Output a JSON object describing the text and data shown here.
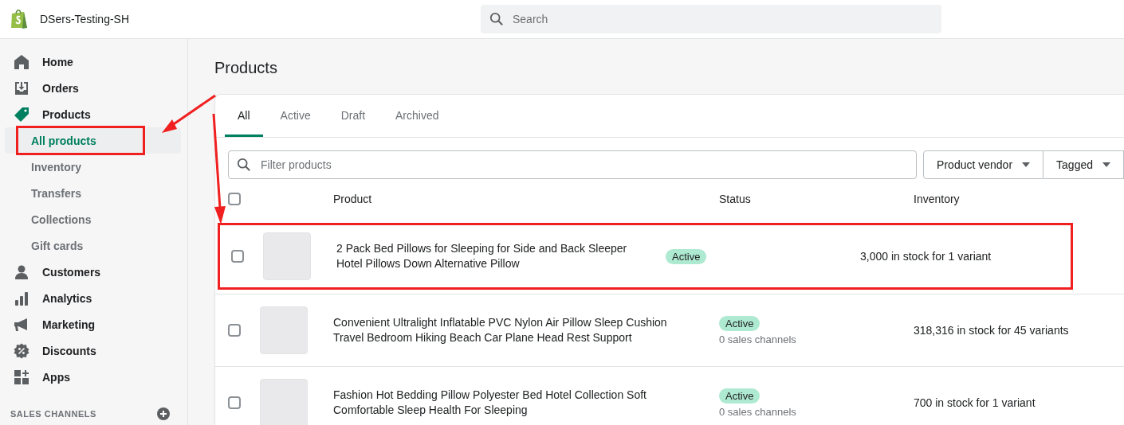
{
  "store": {
    "name": "DSers-Testing-SH"
  },
  "search": {
    "placeholder": "Search"
  },
  "sidebar": {
    "items": [
      {
        "label": "Home",
        "selected": false
      },
      {
        "label": "Orders",
        "selected": false
      },
      {
        "label": "Products",
        "selected": true,
        "children": [
          {
            "label": "All products",
            "selected": true,
            "highlighted": true
          },
          {
            "label": "Inventory",
            "selected": false,
            "highlighted": false
          },
          {
            "label": "Transfers",
            "selected": false,
            "highlighted": false
          },
          {
            "label": "Collections",
            "selected": false,
            "highlighted": false
          },
          {
            "label": "Gift cards",
            "selected": false,
            "highlighted": false
          }
        ]
      },
      {
        "label": "Customers",
        "selected": false
      },
      {
        "label": "Analytics",
        "selected": false
      },
      {
        "label": "Marketing",
        "selected": false
      },
      {
        "label": "Discounts",
        "selected": false
      },
      {
        "label": "Apps",
        "selected": false
      }
    ],
    "section_heading": "SALES CHANNELS"
  },
  "page": {
    "title": "Products"
  },
  "tabs": [
    {
      "label": "All",
      "selected": true
    },
    {
      "label": "Active",
      "selected": false
    },
    {
      "label": "Draft",
      "selected": false
    },
    {
      "label": "Archived",
      "selected": false
    }
  ],
  "filter": {
    "placeholder": "Filter products"
  },
  "filter_buttons": [
    "Product vendor",
    "Tagged"
  ],
  "table": {
    "select_all": {
      "checked": false
    },
    "columns": [
      "Product",
      "Status",
      "Inventory"
    ],
    "rows": [
      {
        "name": "2 Pack Bed Pillows for Sleeping for Side and Back Sleeper Hotel Pillows Down Alternative Pillow",
        "status": "Active",
        "inventory": "3,000 in stock for 1 variant",
        "checked": false,
        "highlighted": true
      },
      {
        "name": "Convenient Ultralight Inflatable PVC Nylon Air Pillow Sleep Cushion Travel Bedroom Hiking Beach Car Plane Head Rest Support",
        "status": "Active",
        "channels": "0 sales channels",
        "inventory": "318,316 in stock for 45 variants",
        "checked": false,
        "highlighted": false
      },
      {
        "name": "Fashion Hot Bedding Pillow Polyester Bed Hotel Collection Soft Comfortable Sleep Health For Sleeping",
        "status": "Active",
        "channels": "0 sales channels",
        "inventory": "700 in stock for 1 variant",
        "checked": false,
        "highlighted": false
      }
    ]
  }
}
